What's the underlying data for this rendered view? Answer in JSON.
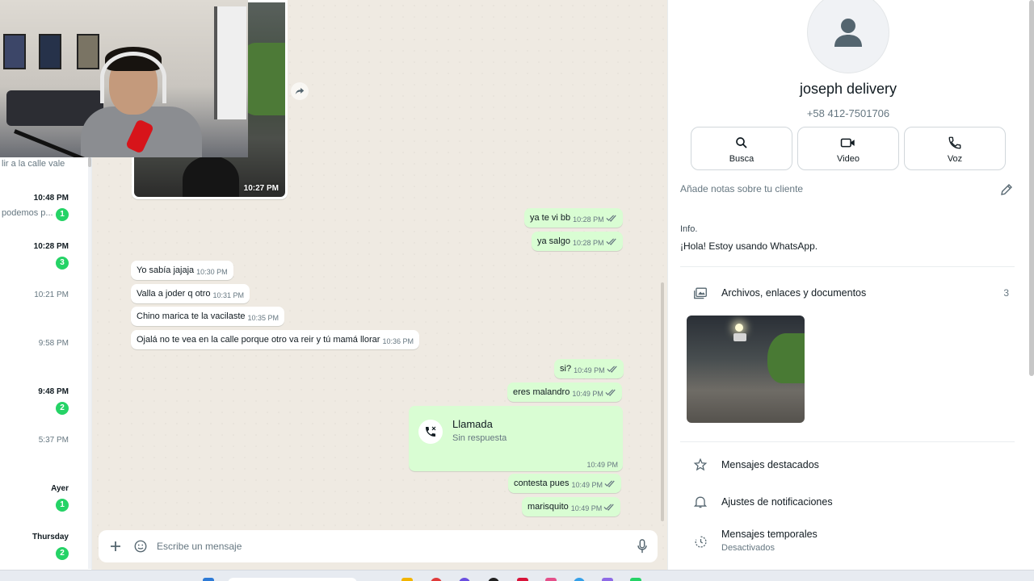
{
  "chat_list": {
    "top_snippet": "lir a la calle vale",
    "rows": [
      {
        "time": "10:48 PM",
        "snippet": "podemos p...",
        "badge": "1",
        "bold": true
      },
      {
        "time": "10:28 PM",
        "snippet": "",
        "badge": "3",
        "bold": true
      },
      {
        "time": "10:21 PM",
        "snippet": "",
        "badge": "",
        "bold": false
      },
      {
        "time": "9:58 PM",
        "snippet": "",
        "badge": "",
        "bold": false
      },
      {
        "time": "9:48 PM",
        "snippet": "",
        "badge": "2",
        "bold": true
      },
      {
        "time": "5:37 PM",
        "snippet": "",
        "badge": "",
        "bold": false
      },
      {
        "time": "Ayer",
        "snippet": "",
        "badge": "1",
        "bold": true
      },
      {
        "time": "Thursday",
        "snippet": "",
        "badge": "2",
        "bold": true
      }
    ]
  },
  "conversation": {
    "image_message": {
      "time": "10:27 PM"
    },
    "messages": [
      {
        "dir": "out",
        "text": "ya te vi bb",
        "time": "10:28 PM",
        "read": true
      },
      {
        "dir": "out",
        "text": "ya salgo",
        "time": "10:28 PM",
        "read": true
      },
      {
        "dir": "in",
        "text": "Yo sabía jajaja",
        "time": "10:30 PM"
      },
      {
        "dir": "in",
        "text": "Valla a joder q otro",
        "time": "10:31 PM"
      },
      {
        "dir": "in",
        "text": "Chino marica te la vacilaste",
        "time": "10:35 PM"
      },
      {
        "dir": "in",
        "text": "Ojalá no te vea en la calle porque otro va reir y tú mamá llorar",
        "time": "10:36 PM"
      },
      {
        "dir": "out",
        "text": "si?",
        "time": "10:49 PM",
        "read": true
      },
      {
        "dir": "out",
        "text": "eres malandro",
        "time": "10:49 PM",
        "read": true
      },
      {
        "dir": "out",
        "text": "contesta pues",
        "time": "10:49 PM",
        "read": true
      },
      {
        "dir": "out",
        "text": "marisquito",
        "time": "10:49 PM",
        "read": true
      }
    ],
    "call": {
      "title": "Llamada",
      "subtitle": "Sin respuesta",
      "time": "10:49 PM"
    },
    "composer": {
      "placeholder": "Escribe un mensaje",
      "value": ""
    }
  },
  "contact": {
    "name": "joseph delivery",
    "phone": "+58 412-7501706",
    "actions": [
      {
        "label": "Busca",
        "icon": "search-icon"
      },
      {
        "label": "Video",
        "icon": "video-icon"
      },
      {
        "label": "Voz",
        "icon": "phone-icon"
      }
    ],
    "notes_placeholder": "Añade notas sobre tu cliente",
    "info_label": "Info.",
    "status": "¡Hola! Estoy usando WhatsApp.",
    "files_label": "Archivos, enlaces y documentos",
    "files_count": "3",
    "starred_label": "Mensajes destacados",
    "notifications_label": "Ajustes de notificaciones",
    "temporary_label": "Mensajes temporales",
    "temporary_sub": "Desactivados"
  },
  "colors": {
    "outgoing_bubble": "#d9fdd3",
    "incoming_bubble": "#ffffff",
    "chat_background": "#efeae2",
    "badge_green": "#25d366",
    "read_ticks": "#53bdeb"
  }
}
